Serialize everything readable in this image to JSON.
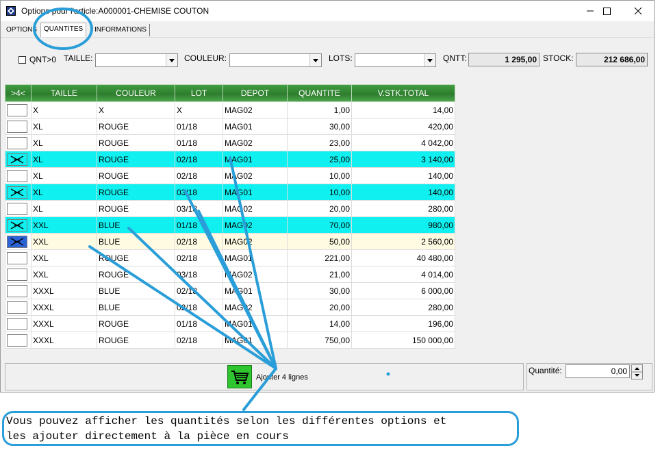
{
  "window": {
    "title": "Options pour l'article:A000001-CHEMISE COUTON",
    "minimize_symbol": "—",
    "maximize_symbol": "☐",
    "close_symbol": "✕"
  },
  "tabs": [
    {
      "label": "OPTIONS",
      "active": false
    },
    {
      "label": "QUANTITES",
      "active": true
    },
    {
      "label": "INFORMATIONS",
      "active": false
    }
  ],
  "filters": {
    "qnt_label": "QNT>0",
    "taille_label": "TAILLE:",
    "couleur_label": "COULEUR:",
    "lots_label": "LOTS:",
    "qntt_label": "QNTT:",
    "qntt_value": "1 295,00",
    "stock_label": "STOCK:",
    "stock_value": "212 686,00"
  },
  "grid": {
    "headers": [
      ">4<",
      "TAILLE",
      "COULEUR",
      "LOT",
      "DEPOT",
      "QUANTITE",
      "V.STK.TOTAL"
    ],
    "rows": [
      {
        "checked": false,
        "state": "normal",
        "taille": "X",
        "couleur": "X",
        "lot": "X",
        "depot": "MAG02",
        "quantite": "1,00",
        "total": "14,00"
      },
      {
        "checked": false,
        "state": "normal",
        "taille": "XL",
        "couleur": "ROUGE",
        "lot": "01/18",
        "depot": "MAG01",
        "quantite": "30,00",
        "total": "420,00"
      },
      {
        "checked": false,
        "state": "normal",
        "taille": "XL",
        "couleur": "ROUGE",
        "lot": "01/18",
        "depot": "MAG02",
        "quantite": "23,00",
        "total": "4 042,00"
      },
      {
        "checked": true,
        "state": "hl",
        "taille": "XL",
        "couleur": "ROUGE",
        "lot": "02/18",
        "depot": "MAG01",
        "quantite": "25,00",
        "total": "3 140,00"
      },
      {
        "checked": false,
        "state": "normal",
        "taille": "XL",
        "couleur": "ROUGE",
        "lot": "02/18",
        "depot": "MAG02",
        "quantite": "10,00",
        "total": "140,00"
      },
      {
        "checked": true,
        "state": "hl",
        "taille": "XL",
        "couleur": "ROUGE",
        "lot": "03/18",
        "depot": "MAG01",
        "quantite": "10,00",
        "total": "140,00"
      },
      {
        "checked": false,
        "state": "normal",
        "taille": "XL",
        "couleur": "ROUGE",
        "lot": "03/18",
        "depot": "MAG02",
        "quantite": "20,00",
        "total": "280,00"
      },
      {
        "checked": true,
        "state": "hl",
        "taille": "XXL",
        "couleur": "BLUE",
        "lot": "01/18",
        "depot": "MAG02",
        "quantite": "70,00",
        "total": "980,00"
      },
      {
        "checked": true,
        "state": "cur",
        "taille": "XXL",
        "couleur": "BLUE",
        "lot": "02/18",
        "depot": "MAG02",
        "quantite": "50,00",
        "total": "2 560,00"
      },
      {
        "checked": false,
        "state": "normal",
        "taille": "XXL",
        "couleur": "ROUGE",
        "lot": "02/18",
        "depot": "MAG01",
        "quantite": "221,00",
        "total": "40 480,00"
      },
      {
        "checked": false,
        "state": "normal",
        "taille": "XXL",
        "couleur": "ROUGE",
        "lot": "03/18",
        "depot": "MAG02",
        "quantite": "21,00",
        "total": "4 014,00"
      },
      {
        "checked": false,
        "state": "normal",
        "taille": "XXXL",
        "couleur": "BLUE",
        "lot": "02/18",
        "depot": "MAG01",
        "quantite": "30,00",
        "total": "6 000,00"
      },
      {
        "checked": false,
        "state": "normal",
        "taille": "XXXL",
        "couleur": "BLUE",
        "lot": "02/18",
        "depot": "MAG02",
        "quantite": "20,00",
        "total": "280,00"
      },
      {
        "checked": false,
        "state": "normal",
        "taille": "XXXL",
        "couleur": "ROUGE",
        "lot": "01/18",
        "depot": "MAG01",
        "quantite": "14,00",
        "total": "196,00"
      },
      {
        "checked": false,
        "state": "normal",
        "taille": "XXXL",
        "couleur": "ROUGE",
        "lot": "02/18",
        "depot": "MAG01",
        "quantite": "750,00",
        "total": "150 000,00"
      }
    ]
  },
  "bottom": {
    "add_label": "Ajouter 4 lignes",
    "quantite_label": "Quantité:",
    "quantite_value": "0,00"
  },
  "callout": {
    "line1": "Vous pouvez afficher les quantités selon les différentes options et",
    "line2": "les ajouter directement à la pièce en cours"
  },
  "colors": {
    "accent": "#2a9ed8",
    "header_green": "#2e7d2e",
    "highlight_cyan": "#11f0f0",
    "current_row": "#fffbe2",
    "cart_green": "#2ec52e"
  }
}
